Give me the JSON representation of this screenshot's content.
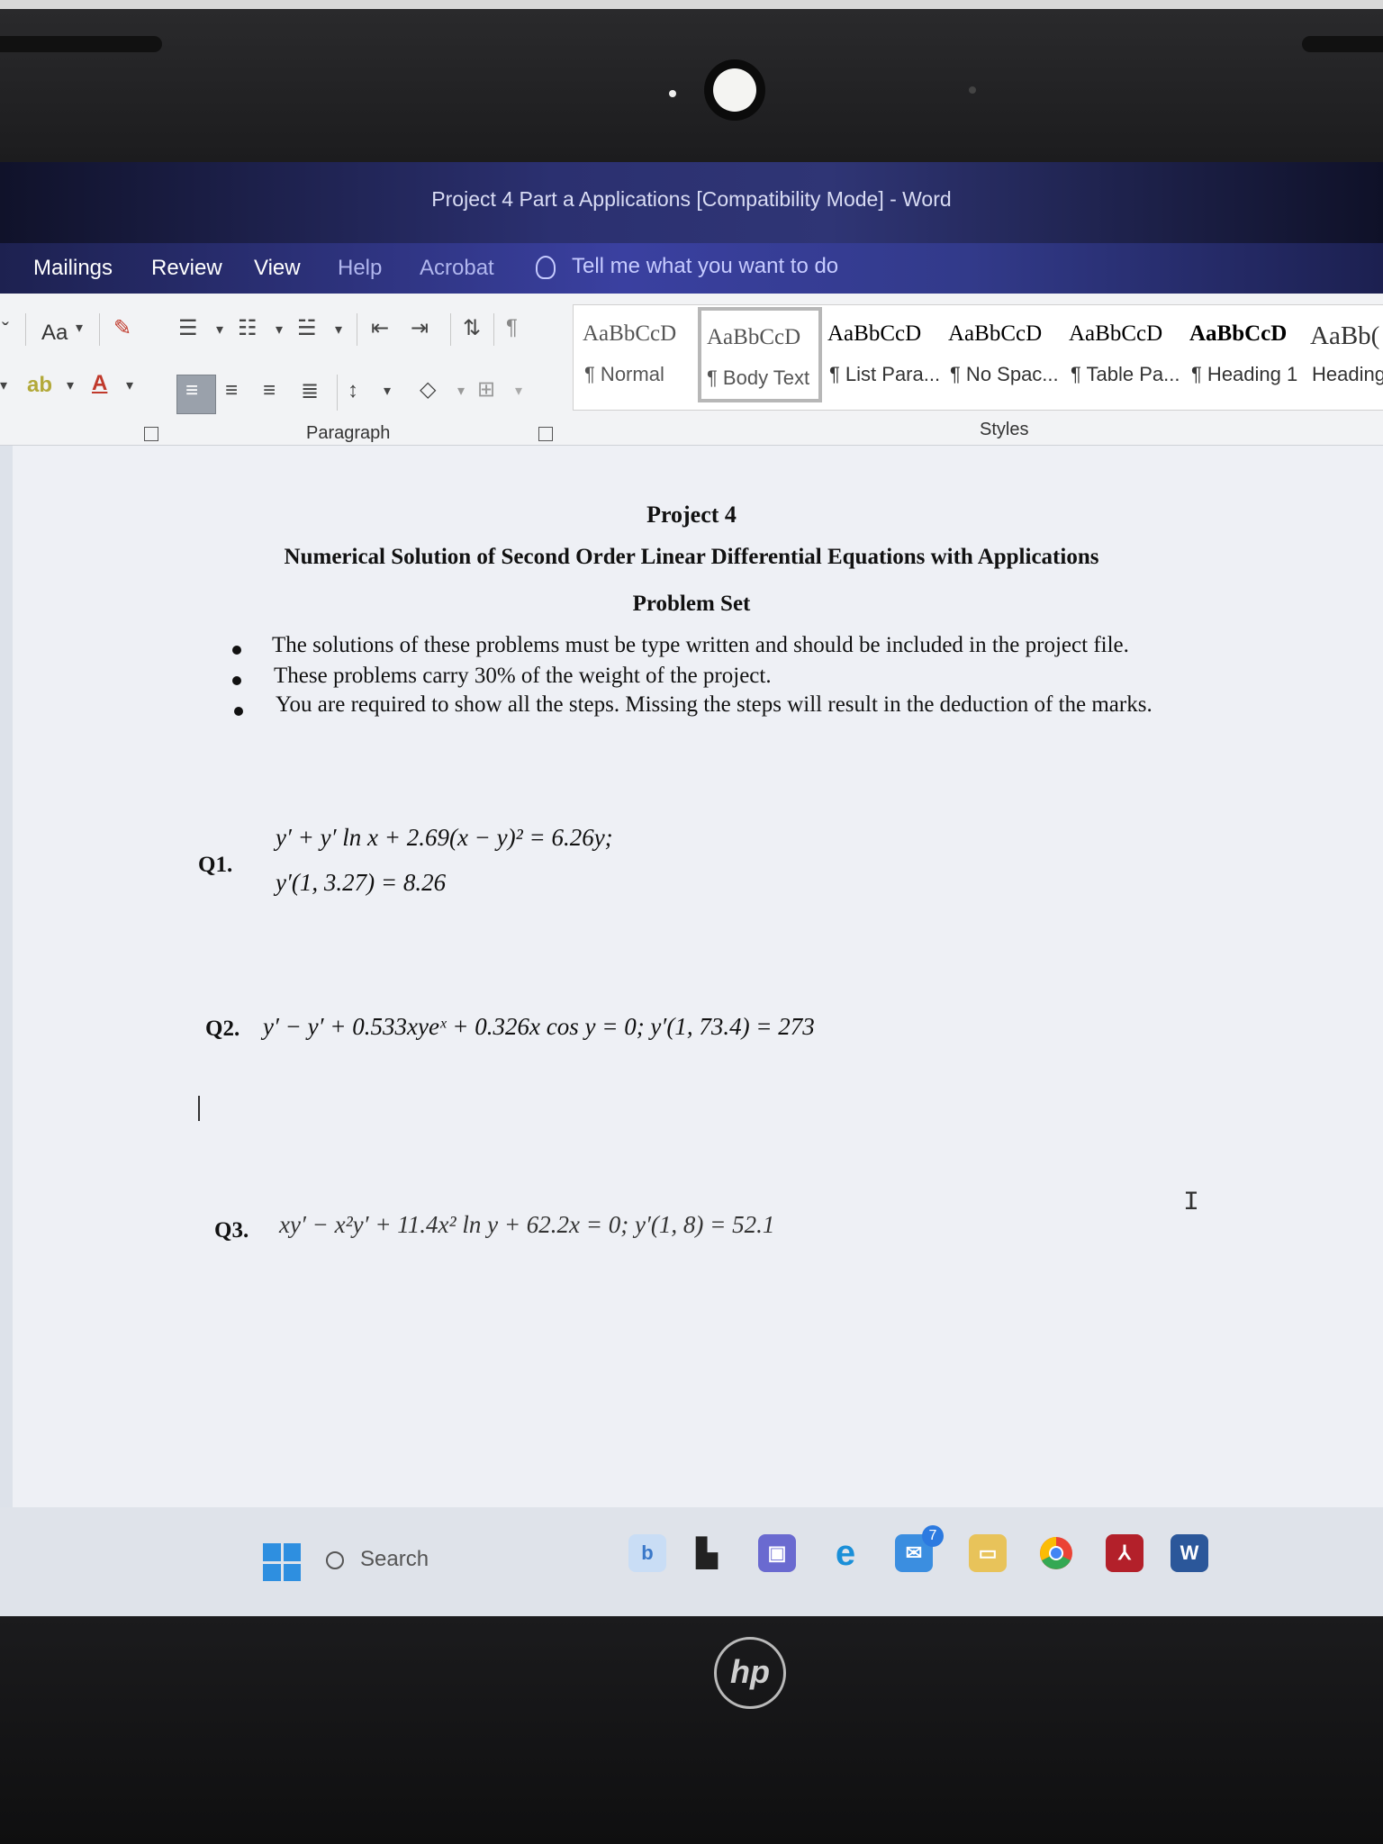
{
  "window": {
    "title": "Project 4 Part a  Applications [Compatibility Mode]  -  Word"
  },
  "menu": {
    "items": [
      "Mailings",
      "Review",
      "View",
      "Help",
      "Acrobat"
    ],
    "tell_me": "Tell me what you want to do"
  },
  "ribbon": {
    "font_case_label": "Aa",
    "paragraph_group_label": "Paragraph",
    "styles_group_label": "Styles",
    "styles": [
      {
        "sample": "AaBbCcD",
        "name": "¶ Normal"
      },
      {
        "sample": "AaBbCcD",
        "name": "¶ Body Text"
      },
      {
        "sample": "AaBbCcD",
        "name": "¶ List Para..."
      },
      {
        "sample": "AaBbCcD",
        "name": "¶ No Spac..."
      },
      {
        "sample": "AaBbCcD",
        "name": "¶ Table Pa..."
      },
      {
        "sample": "AaBbCcD",
        "name": "¶ Heading 1"
      },
      {
        "sample": "AaBb(",
        "name": "Heading"
      }
    ],
    "active_style": "Body Text"
  },
  "document": {
    "heading": "Project 4",
    "subtitle": "Numerical Solution of Second Order Linear Differential Equations with Applications",
    "section": "Problem Set",
    "bullets": [
      "The solutions of these problems must be type written and should be included in the project file.",
      "These problems carry 30% of the weight of the project.",
      "You are required to show all the steps. Missing the steps will result in the deduction of the marks."
    ],
    "questions": [
      {
        "label": "Q1.",
        "line1": "y′ + y′ ln x + 2.69(x − y)² = 6.26y;",
        "line2": "y′(1, 3.27) = 8.26"
      },
      {
        "label": "Q2.",
        "line1": "y′ − y′ + 0.533xyeˣ + 0.326x cos y = 0;   y′(1, 73.4) = 273"
      },
      {
        "label": "Q3.",
        "line1": "xy′ − x²y′ + 11.4x² ln y + 62.2x = 0;   y′(1, 8) = 52.1"
      }
    ]
  },
  "taskbar": {
    "search_label": "Search",
    "mail_badge": "7"
  },
  "colors": {
    "title_bar": "#2b3070",
    "ribbon": "#f2f3f5",
    "page": "#eef0f5",
    "windows_accent": "#2e8fe0"
  }
}
